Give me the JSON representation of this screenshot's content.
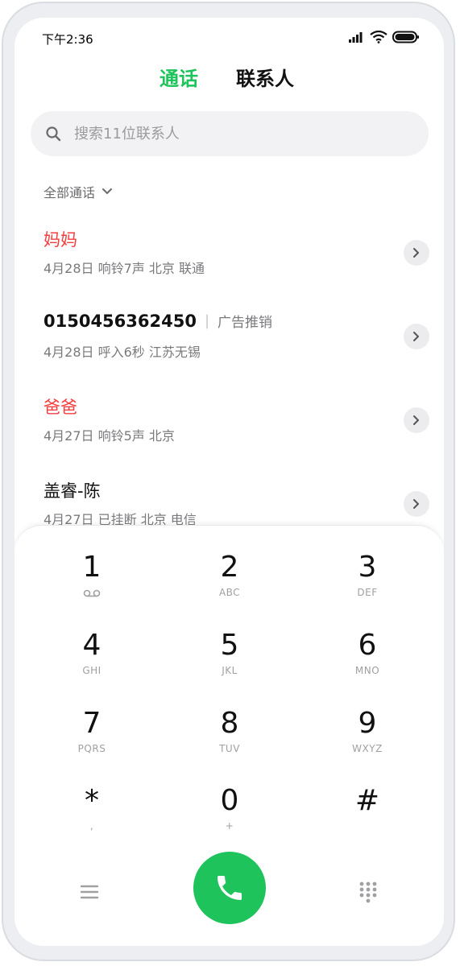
{
  "status_bar": {
    "time": "下午2:36"
  },
  "tabs": {
    "calls": "通话",
    "contacts": "联系人"
  },
  "search": {
    "placeholder": "搜索11位联系人"
  },
  "filter": {
    "label": "全部通话"
  },
  "calls": [
    {
      "name": "妈妈",
      "missed": true,
      "detail": "4月28日 响铃7声 北京 联通"
    },
    {
      "number": "0150456362450",
      "sep": "|",
      "tag": "广告推销",
      "missed": false,
      "detail": "4月28日 呼入6秒 江苏无锡"
    },
    {
      "name": "爸爸",
      "missed": true,
      "detail": "4月27日 响铃5声 北京"
    },
    {
      "name": "盖睿-陈",
      "missed": false,
      "detail": "4月27日 已挂断 北京 电信"
    }
  ],
  "keys": [
    {
      "digit": "1",
      "letters": ""
    },
    {
      "digit": "2",
      "letters": "ABC"
    },
    {
      "digit": "3",
      "letters": "DEF"
    },
    {
      "digit": "4",
      "letters": "GHI"
    },
    {
      "digit": "5",
      "letters": "JKL"
    },
    {
      "digit": "6",
      "letters": "MNO"
    },
    {
      "digit": "7",
      "letters": "PQRS"
    },
    {
      "digit": "8",
      "letters": "TUV"
    },
    {
      "digit": "9",
      "letters": "WXYZ"
    },
    {
      "digit": "*",
      "letters": ","
    },
    {
      "digit": "0",
      "letters": "+"
    },
    {
      "digit": "#",
      "letters": ""
    }
  ],
  "icons": {
    "signal": "signal-icon",
    "wifi": "wifi-icon",
    "battery": "battery-icon",
    "search": "search-icon",
    "chevron": "chevron-down-icon",
    "detail": "chevron-right-icon",
    "voicemail": "voicemail-icon",
    "menu": "menu-icon",
    "phone": "phone-icon",
    "keypad": "keypad-icon"
  },
  "colors": {
    "accent": "#1ec35b",
    "missed": "#f43f3f"
  }
}
